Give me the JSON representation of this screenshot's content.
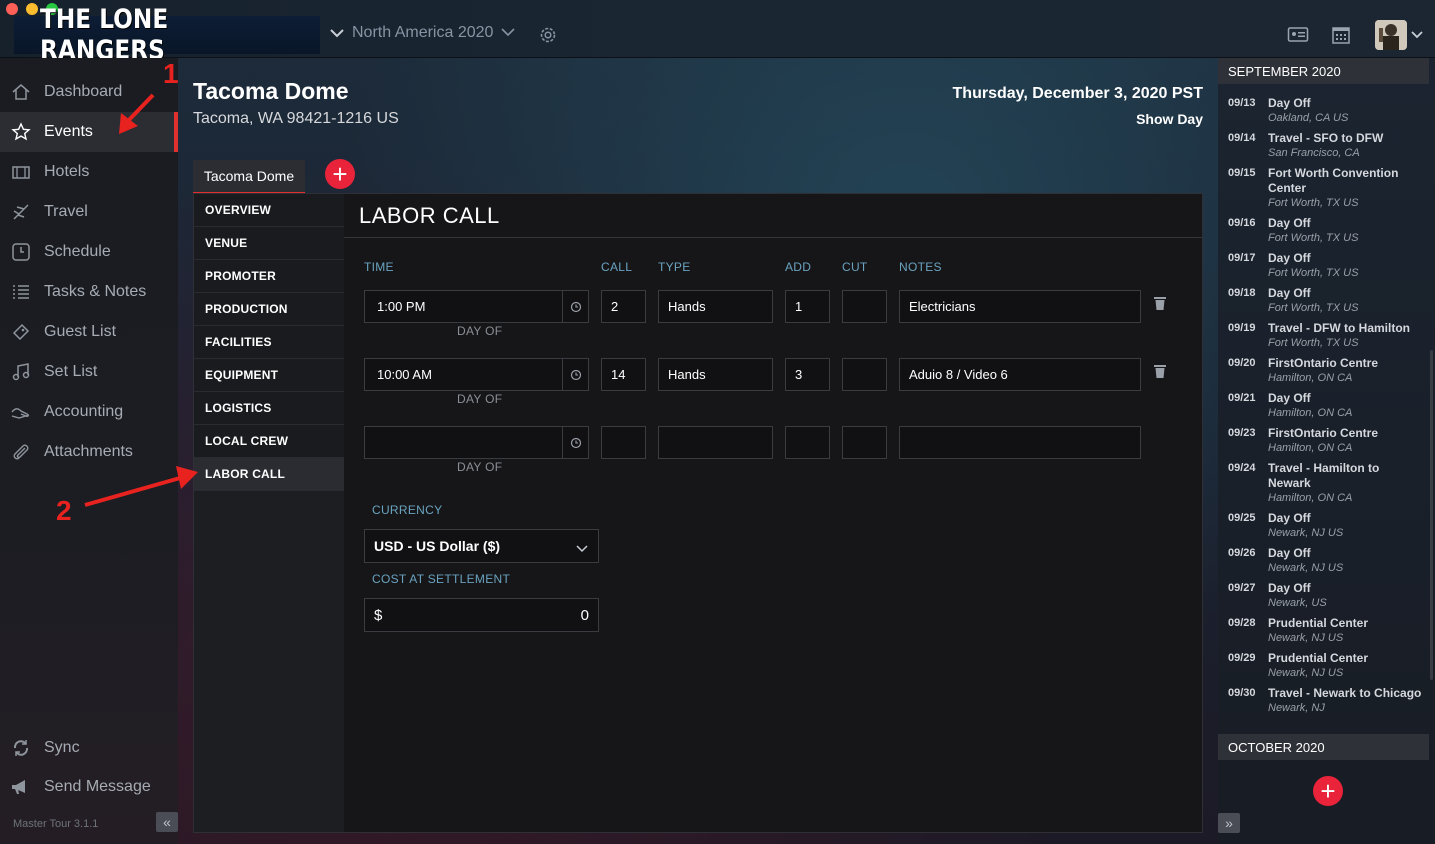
{
  "app": {
    "logo_text": "THE LONE RANGERS",
    "tour_name": "North America 2020",
    "version": "Master Tour 3.1.1"
  },
  "colors": {
    "accent_red": "#e0312f",
    "add_red": "#e8233a",
    "label_blue": "#6aa3c0"
  },
  "sidebar": {
    "items": [
      {
        "label": "Dashboard",
        "icon": "home-icon"
      },
      {
        "label": "Events",
        "icon": "star-icon",
        "active": true
      },
      {
        "label": "Hotels",
        "icon": "hotel-icon"
      },
      {
        "label": "Travel",
        "icon": "plane-icon"
      },
      {
        "label": "Schedule",
        "icon": "clock-icon"
      },
      {
        "label": "Tasks & Notes",
        "icon": "checklist-icon"
      },
      {
        "label": "Guest List",
        "icon": "ticket-icon"
      },
      {
        "label": "Set List",
        "icon": "music-icon"
      },
      {
        "label": "Accounting",
        "icon": "money-icon"
      },
      {
        "label": "Attachments",
        "icon": "paperclip-icon"
      }
    ],
    "bottom": [
      {
        "label": "Sync",
        "icon": "sync-icon"
      },
      {
        "label": "Send Message",
        "icon": "megaphone-icon"
      }
    ]
  },
  "event": {
    "venue": "Tacoma Dome",
    "address": "Tacoma, WA 98421-1216 US",
    "date": "Thursday, December 3, 2020 PST",
    "day_type": "Show Day",
    "tab_label": "Tacoma Dome"
  },
  "subnav": [
    "OVERVIEW",
    "VENUE",
    "PROMOTER",
    "PRODUCTION",
    "FACILITIES",
    "EQUIPMENT",
    "LOGISTICS",
    "LOCAL CREW",
    "LABOR CALL"
  ],
  "labor_call": {
    "title": "LABOR CALL",
    "columns": {
      "time": "TIME",
      "call": "CALL",
      "type": "TYPE",
      "add": "ADD",
      "cut": "CUT",
      "notes": "NOTES"
    },
    "day_of_label": "DAY OF",
    "rows": [
      {
        "time": "1:00 PM",
        "call": "2",
        "type": "Hands",
        "add": "1",
        "cut": "",
        "notes": "Electricians"
      },
      {
        "time": "10:00 AM",
        "call": "14",
        "type": "Hands",
        "add": "3",
        "cut": "",
        "notes": "Aduio 8 / Video 6"
      },
      {
        "time": "",
        "call": "",
        "type": "",
        "add": "",
        "cut": "",
        "notes": ""
      }
    ],
    "currency_label": "CURRENCY",
    "currency_value": "USD - US Dollar ($)",
    "cost_label": "COST AT SETTLEMENT",
    "cost_symbol": "$",
    "cost_value": "0"
  },
  "calendar": {
    "months": [
      "SEPTEMBER 2020",
      "OCTOBER 2020"
    ],
    "partial_top": "Oakland, CA US",
    "items": [
      {
        "date": "09/13",
        "title": "Day Off",
        "loc": "Oakland, CA US"
      },
      {
        "date": "09/14",
        "title": "Travel - SFO to DFW",
        "loc": "San Francisco, CA"
      },
      {
        "date": "09/15",
        "title": "Fort Worth Convention Center",
        "loc": "Fort Worth, TX US"
      },
      {
        "date": "09/16",
        "title": "Day Off",
        "loc": "Fort Worth, TX US"
      },
      {
        "date": "09/17",
        "title": "Day Off",
        "loc": "Fort Worth, TX US"
      },
      {
        "date": "09/18",
        "title": "Day Off",
        "loc": "Fort Worth, TX US"
      },
      {
        "date": "09/19",
        "title": "Travel - DFW to Hamilton",
        "loc": "Fort Worth, TX US"
      },
      {
        "date": "09/20",
        "title": "FirstOntario Centre",
        "loc": "Hamilton, ON CA"
      },
      {
        "date": "09/21",
        "title": "Day Off",
        "loc": "Hamilton, ON CA"
      },
      {
        "date": "09/23",
        "title": "FirstOntario Centre",
        "loc": "Hamilton, ON CA"
      },
      {
        "date": "09/24",
        "title": "Travel - Hamilton to Newark",
        "loc": "Hamilton, ON CA"
      },
      {
        "date": "09/25",
        "title": "Day Off",
        "loc": "Newark, NJ US"
      },
      {
        "date": "09/26",
        "title": "Day Off",
        "loc": "Newark, NJ US"
      },
      {
        "date": "09/27",
        "title": "Day Off",
        "loc": "Newark, US"
      },
      {
        "date": "09/28",
        "title": "Prudential Center",
        "loc": "Newark, NJ US"
      },
      {
        "date": "09/29",
        "title": "Prudential Center",
        "loc": "Newark, NJ US"
      },
      {
        "date": "09/30",
        "title": "Travel - Newark to Chicago",
        "loc": "Newark, NJ"
      }
    ]
  },
  "annotations": {
    "one": "1",
    "two": "2"
  }
}
